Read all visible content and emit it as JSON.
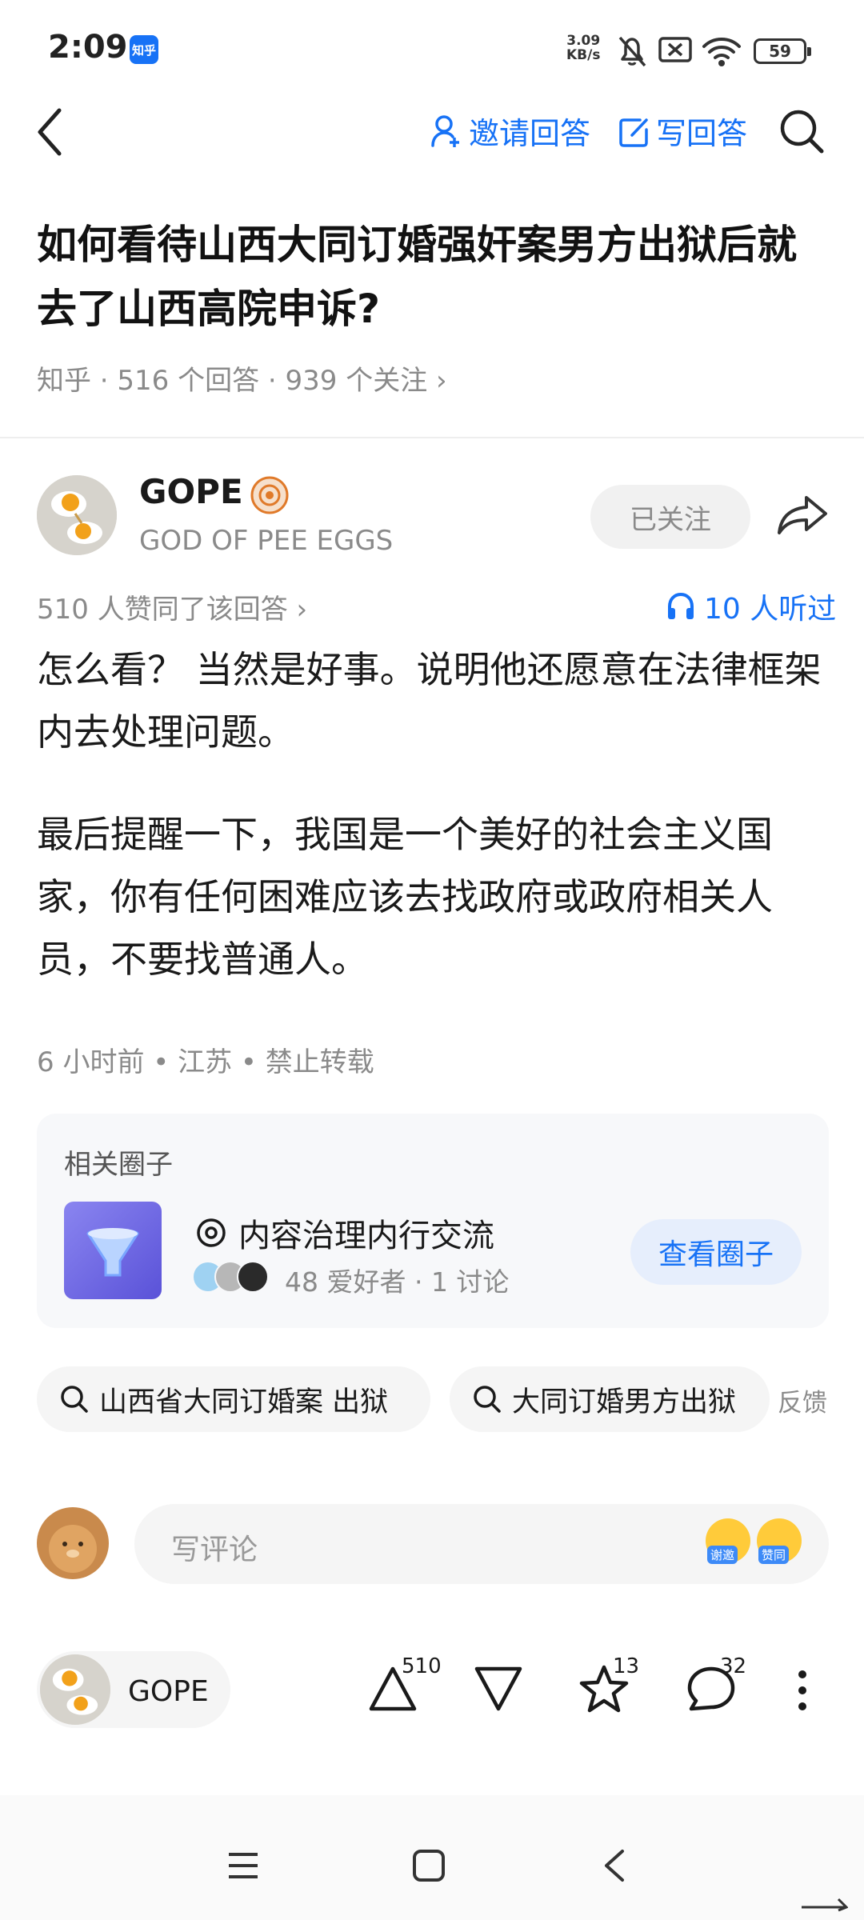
{
  "status_bar": {
    "time": "2:09",
    "app_badge": "知乎",
    "net_speed_value": "3.09",
    "net_speed_unit": "KB/s",
    "battery": "59"
  },
  "nav": {
    "invite_label": "邀请回答",
    "write_label": "写回答"
  },
  "question": {
    "title": "如何看待山西大同订婚强奸案男方出狱后就去了山西高院申诉?",
    "meta": "知乎 · 516 个回答 · 939 个关注 ›"
  },
  "author": {
    "name": "GOPE",
    "bio": "GOD OF PEE EGGS",
    "follow_label": "已关注"
  },
  "answer": {
    "votes_line": "510 人赞同了该回答 ›",
    "listened": "10 人听过",
    "paragraphs": [
      "怎么看？ 当然是好事。说明他还愿意在法律框架内去处理问题。",
      "最后提醒一下，我国是一个美好的社会主义国家，你有任何困难应该去找政府或政府相关人员，不要找普通人。"
    ],
    "meta": "6 小时前 • 江苏 • 禁止转载"
  },
  "related_circle": {
    "heading": "相关圈子",
    "name": "内容治理内行交流",
    "stats": "48 爱好者 · 1 讨论",
    "button_label": "查看圈子"
  },
  "search_chips": [
    "山西省大同订婚案 出狱",
    "大同订婚男方出狱"
  ],
  "feedback_label": "反馈",
  "comment": {
    "placeholder": "写评论",
    "emoji_tags": [
      "谢邀",
      "赞同"
    ]
  },
  "action_bar": {
    "author_name": "GOPE",
    "upvote_count": "510",
    "favorite_count": "13",
    "comment_count": "32"
  },
  "colors": {
    "accent": "#1772f6",
    "muted_text": "#8a8a8a",
    "chip_bg": "#f5f5f5"
  }
}
